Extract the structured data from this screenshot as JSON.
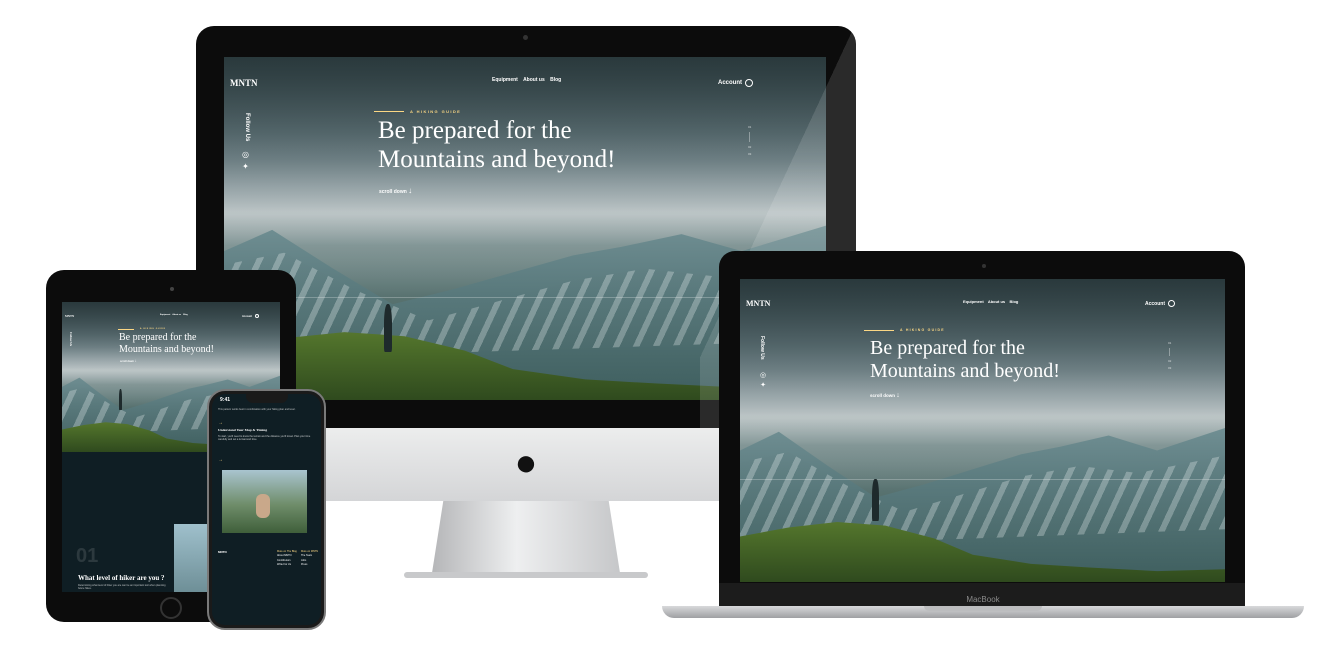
{
  "site": {
    "logo": "MNTN",
    "nav": [
      "Equipment",
      "About us",
      "Blog"
    ],
    "account": "Account",
    "eyebrow": "A HIKING GUIDE",
    "headline_line1": "Be prepared for the",
    "headline_line2": "Mountains and beyond!",
    "scroll": "scroll down",
    "follow": "Follow Us",
    "pager": [
      "01",
      "02",
      "03"
    ]
  },
  "ipad": {
    "step_number": "01",
    "step_title": "What level of hiker are you ?",
    "step_sub": "Determining what level of hiker you are can be an important tool when planning future hikes."
  },
  "iphone": {
    "time": "9:41",
    "intro": "This pattern works best in combination with your hiking plan and level.",
    "section_title": "Understand Your Map & Timing",
    "section_body": "To start, you'll need to know the terrain and the distance you'll travel. Plan your time carefully and set a turnaround time.",
    "footer_cols": [
      [
        "More on The Blog",
        "About MNTN",
        "Contributors",
        "Write For Us"
      ],
      [
        "More on MNTN",
        "The Team",
        "Jobs",
        "Press"
      ]
    ]
  },
  "macbook": {
    "label": "MacBook"
  },
  "icons": {
    "apple": "apple-logo-icon",
    "instagram": "instagram-icon",
    "twitter": "twitter-icon",
    "account": "account-icon",
    "arrow": "arrow-down-icon"
  },
  "colors": {
    "accent": "#fbd784",
    "dark": "#0b1d26"
  }
}
